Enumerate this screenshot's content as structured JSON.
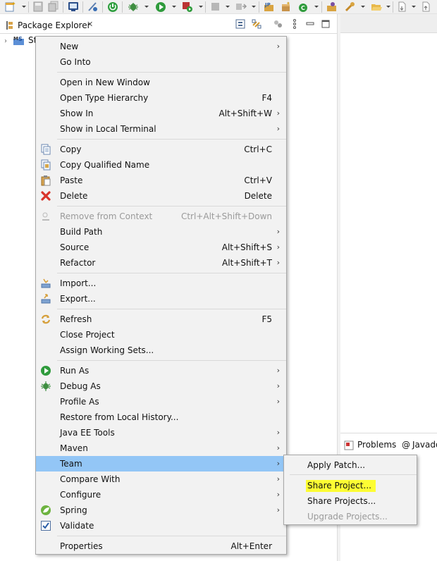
{
  "toolbar": {
    "icons": [
      "new-icon",
      "save-icon",
      "save-all-icon",
      "terminal-icon",
      "skip-breakpoints-icon",
      "power-icon",
      "debug-icon",
      "run-icon",
      "external-tools-icon",
      "stop-icon",
      "server-icon",
      "new-java-project-icon",
      "new-package-icon",
      "new-class-icon",
      "open-type-icon",
      "search-icon",
      "open-folder-icon",
      "next-annotation-icon",
      "back-icon"
    ]
  },
  "package_explorer": {
    "title": "Package Explorer",
    "close": "✕",
    "tree": {
      "arrow": "›",
      "label": "St"
    }
  },
  "bottom_pane": {
    "tabs": [
      {
        "label": "Problems"
      },
      {
        "label": "Javado"
      }
    ],
    "at_sign": "@"
  },
  "context_menu": {
    "items": [
      {
        "label": "New",
        "shortcut": "",
        "submenu": true,
        "icon": ""
      },
      {
        "label": "Go Into",
        "shortcut": "",
        "submenu": false,
        "icon": ""
      },
      {
        "label": "Open in New Window",
        "shortcut": "",
        "submenu": false,
        "icon": ""
      },
      {
        "label": "Open Type Hierarchy",
        "shortcut": "F4",
        "submenu": false,
        "icon": ""
      },
      {
        "label": "Show In",
        "shortcut": "Alt+Shift+W",
        "submenu": true,
        "icon": ""
      },
      {
        "label": "Show in Local Terminal",
        "shortcut": "",
        "submenu": true,
        "icon": ""
      },
      {
        "label": "Copy",
        "shortcut": "Ctrl+C",
        "submenu": false,
        "icon": "copy-icon"
      },
      {
        "label": "Copy Qualified Name",
        "shortcut": "",
        "submenu": false,
        "icon": "copy-qualified-name-icon"
      },
      {
        "label": "Paste",
        "shortcut": "Ctrl+V",
        "submenu": false,
        "icon": "paste-icon"
      },
      {
        "label": "Delete",
        "shortcut": "Delete",
        "submenu": false,
        "icon": "delete-icon"
      },
      {
        "label": "Remove from Context",
        "shortcut": "Ctrl+Alt+Shift+Down",
        "submenu": false,
        "icon": "remove-context-icon",
        "disabled": true
      },
      {
        "label": "Build Path",
        "shortcut": "",
        "submenu": true,
        "icon": ""
      },
      {
        "label": "Source",
        "shortcut": "Alt+Shift+S",
        "submenu": true,
        "icon": ""
      },
      {
        "label": "Refactor",
        "shortcut": "Alt+Shift+T",
        "submenu": true,
        "icon": ""
      },
      {
        "label": "Import...",
        "shortcut": "",
        "submenu": false,
        "icon": "import-icon"
      },
      {
        "label": "Export...",
        "shortcut": "",
        "submenu": false,
        "icon": "export-icon"
      },
      {
        "label": "Refresh",
        "shortcut": "F5",
        "submenu": false,
        "icon": "refresh-icon"
      },
      {
        "label": "Close Project",
        "shortcut": "",
        "submenu": false,
        "icon": ""
      },
      {
        "label": "Assign Working Sets...",
        "shortcut": "",
        "submenu": false,
        "icon": ""
      },
      {
        "label": "Run As",
        "shortcut": "",
        "submenu": true,
        "icon": "run-icon"
      },
      {
        "label": "Debug As",
        "shortcut": "",
        "submenu": true,
        "icon": "debug-icon"
      },
      {
        "label": "Profile As",
        "shortcut": "",
        "submenu": true,
        "icon": ""
      },
      {
        "label": "Restore from Local History...",
        "shortcut": "",
        "submenu": false,
        "icon": ""
      },
      {
        "label": "Java EE Tools",
        "shortcut": "",
        "submenu": true,
        "icon": ""
      },
      {
        "label": "Maven",
        "shortcut": "",
        "submenu": true,
        "icon": ""
      },
      {
        "label": "Team",
        "shortcut": "",
        "submenu": true,
        "icon": "",
        "selected": true
      },
      {
        "label": "Compare With",
        "shortcut": "",
        "submenu": true,
        "icon": ""
      },
      {
        "label": "Configure",
        "shortcut": "",
        "submenu": true,
        "icon": ""
      },
      {
        "label": "Spring",
        "shortcut": "",
        "submenu": true,
        "icon": "spring-icon"
      },
      {
        "label": "Validate",
        "shortcut": "",
        "submenu": false,
        "icon": "validate-icon"
      },
      {
        "label": "Properties",
        "shortcut": "Alt+Enter",
        "submenu": false,
        "icon": ""
      }
    ]
  },
  "team_submenu": {
    "items": [
      {
        "label": "Apply Patch..."
      },
      {
        "label": "Share Project...",
        "highlighted": true
      },
      {
        "label": "Share Projects..."
      },
      {
        "label": "Upgrade Projects...",
        "disabled": true
      }
    ]
  },
  "colors": {
    "menu_bg": "#f2f2f2",
    "menu_selected": "#93c6f6",
    "highlight": "#fdfd33",
    "disabled_text": "#9a9a9a"
  }
}
